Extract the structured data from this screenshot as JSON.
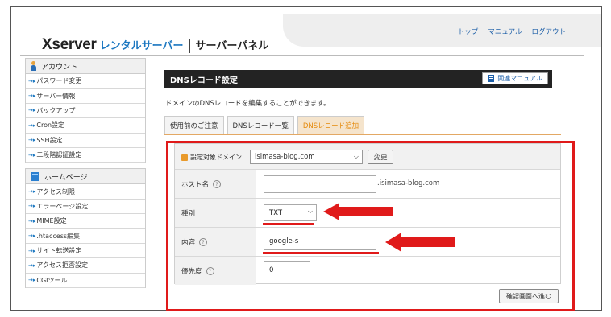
{
  "header": {
    "logo_x": "Xserver",
    "logo_rental": "レンタルサーバー",
    "logo_panel": "サーバーパネル",
    "links": [
      "トップ",
      "マニュアル",
      "ログアウト"
    ]
  },
  "sidebar": {
    "account_title": "アカウント",
    "account_items": [
      "パスワード変更",
      "サーバー情報",
      "バックアップ",
      "Cron設定",
      "SSH設定",
      "二段階認証設定"
    ],
    "homepage_title": "ホームページ",
    "homepage_items": [
      "アクセス制限",
      "エラーページ設定",
      "MIME設定",
      ".htaccess編集",
      "サイト転送設定",
      "アクセス拒否設定",
      "CGIツール"
    ]
  },
  "main": {
    "title": "DNSレコード設定",
    "manual_button": "関連マニュアル",
    "description": "ドメインのDNSレコードを編集することができます。",
    "tabs": [
      "使用前のご注意",
      "DNSレコード一覧",
      "DNSレコード追加"
    ],
    "active_tab": 2,
    "form": {
      "domain_label": "設定対象ドメイン",
      "domain_value": "isimasa-blog.com",
      "change_button": "変更",
      "host_label": "ホスト名",
      "host_value": "",
      "host_suffix": ".isimasa-blog.com",
      "type_label": "種別",
      "type_value": "TXT",
      "content_label": "内容",
      "content_value": "google-s",
      "priority_label": "優先度",
      "priority_value": "0",
      "help_mark": "?",
      "confirm_button": "確認画面へ進む"
    }
  },
  "colors": {
    "annotation": "#e01a1a",
    "active_tab_text": "#e58a0b",
    "link": "#1d5fa8"
  }
}
